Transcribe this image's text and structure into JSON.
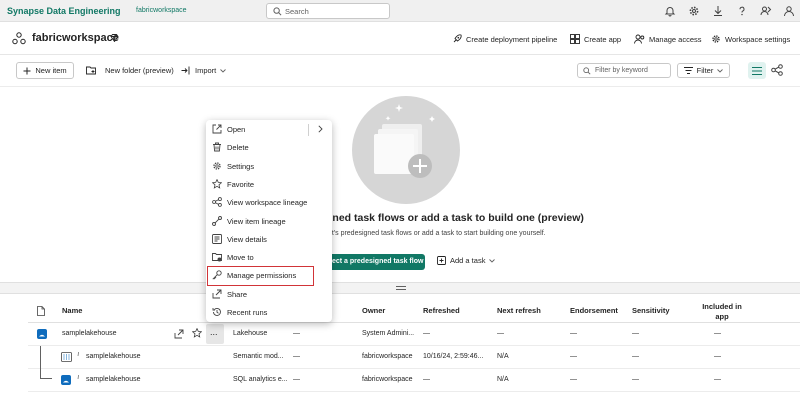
{
  "topbar": {
    "app_title": "Synapse Data Engineering",
    "workspace": "fabricworkspace",
    "search_placeholder": "Search"
  },
  "header": {
    "workspace_name": "fabricworkspace",
    "actions": [
      "Create deployment pipeline",
      "Create app",
      "Manage access",
      "Workspace settings"
    ]
  },
  "toolbar": {
    "new_item": "New item",
    "new_folder": "New folder (preview)",
    "import": "Import",
    "filter_placeholder": "Filter by keyword",
    "filter": "Filter"
  },
  "empty_state": {
    "title": "gned task flows or add a task to build one (preview)",
    "subtitle": "oft's predesigned task flows or add a task to start building one yourself.",
    "select_button": "ect a predesigned task flow",
    "add_task": "Add a task"
  },
  "table": {
    "columns": [
      "Name",
      "Owner",
      "Refreshed",
      "Next refresh",
      "Endorsement",
      "Sensitivity",
      "Included in app"
    ],
    "rows": [
      {
        "name": "samplelakehouse",
        "type": "Lakehouse",
        "task": "—",
        "owner": "System Admini...",
        "refreshed": "—",
        "next_refresh": "—",
        "endorsement": "—",
        "sensitivity": "—",
        "included": "—"
      },
      {
        "name": "samplelakehouse",
        "type": "Semantic mod...",
        "task": "—",
        "owner": "fabricworkspace",
        "refreshed": "10/16/24, 2:59:46...",
        "next_refresh": "N/A",
        "endorsement": "—",
        "sensitivity": "—",
        "included": "—"
      },
      {
        "name": "samplelakehouse",
        "type": "SQL analytics e...",
        "task": "—",
        "owner": "fabricworkspace",
        "refreshed": "—",
        "next_refresh": "N/A",
        "endorsement": "—",
        "sensitivity": "—",
        "included": "—"
      }
    ]
  },
  "context_menu": {
    "items": [
      "Open",
      "Delete",
      "Settings",
      "Favorite",
      "View workspace lineage",
      "View item lineage",
      "View details",
      "Move to",
      "Manage permissions",
      "Share",
      "Recent runs"
    ],
    "highlighted_item": "Manage permissions"
  },
  "more_button": "...",
  "colors": {
    "brand": "#117865",
    "highlight_border": "#d13438",
    "lakehouse_icon": "#0f6cbd"
  }
}
